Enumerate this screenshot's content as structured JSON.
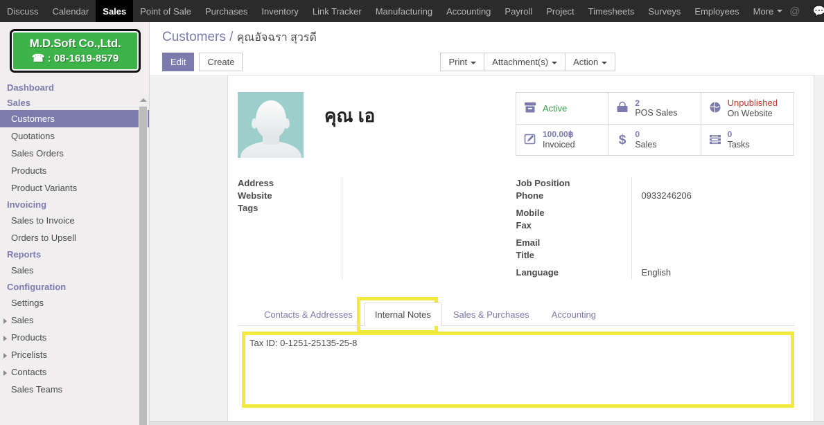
{
  "topbar": {
    "menus": [
      {
        "label": "Discuss",
        "active": false
      },
      {
        "label": "Calendar",
        "active": false
      },
      {
        "label": "Sales",
        "active": true
      },
      {
        "label": "Point of Sale",
        "active": false
      },
      {
        "label": "Purchases",
        "active": false
      },
      {
        "label": "Inventory",
        "active": false
      },
      {
        "label": "Link Tracker",
        "active": false
      },
      {
        "label": "Manufacturing",
        "active": false
      },
      {
        "label": "Accounting",
        "active": false
      },
      {
        "label": "Payroll",
        "active": false
      },
      {
        "label": "Project",
        "active": false
      },
      {
        "label": "Timesheets",
        "active": false
      },
      {
        "label": "Surveys",
        "active": false
      },
      {
        "label": "Employees",
        "active": false
      },
      {
        "label": "More",
        "active": false,
        "caret": true
      }
    ],
    "mention_icon": "@",
    "chat_icon": "messages-icon"
  },
  "sidebar": {
    "logo": {
      "company": "M.D.Soft Co.,Ltd.",
      "phone": "08-1619-8579",
      "phone_prefix": "☎ :",
      "bg_color": "#3db44a"
    },
    "entries": [
      {
        "type": "section",
        "label": "Dashboard"
      },
      {
        "type": "section",
        "label": "Sales"
      },
      {
        "type": "item",
        "label": "Customers",
        "active": true,
        "arrow": false
      },
      {
        "type": "item",
        "label": "Quotations",
        "active": false,
        "arrow": false
      },
      {
        "type": "item",
        "label": "Sales Orders",
        "active": false,
        "arrow": false
      },
      {
        "type": "item",
        "label": "Products",
        "active": false,
        "arrow": false
      },
      {
        "type": "item",
        "label": "Product Variants",
        "active": false,
        "arrow": false
      },
      {
        "type": "section",
        "label": "Invoicing"
      },
      {
        "type": "item",
        "label": "Sales to Invoice",
        "active": false,
        "arrow": false
      },
      {
        "type": "item",
        "label": "Orders to Upsell",
        "active": false,
        "arrow": false
      },
      {
        "type": "section",
        "label": "Reports"
      },
      {
        "type": "item",
        "label": "Sales",
        "active": false,
        "arrow": false
      },
      {
        "type": "section",
        "label": "Configuration"
      },
      {
        "type": "item",
        "label": "Settings",
        "active": false,
        "arrow": false
      },
      {
        "type": "item",
        "label": "Sales",
        "active": false,
        "arrow": true
      },
      {
        "type": "item",
        "label": "Products",
        "active": false,
        "arrow": true
      },
      {
        "type": "item",
        "label": "Pricelists",
        "active": false,
        "arrow": true
      },
      {
        "type": "item",
        "label": "Contacts",
        "active": false,
        "arrow": true
      },
      {
        "type": "item",
        "label": "Sales Teams",
        "active": false,
        "arrow": false
      }
    ]
  },
  "control_panel": {
    "breadcrumb_root": "Customers",
    "breadcrumb_separator": "/",
    "breadcrumb_current": "คุณอัจฉรา สุวรดี",
    "edit_label": "Edit",
    "create_label": "Create",
    "print_label": "Print",
    "attachments_label": "Attachment(s)",
    "action_label": "Action"
  },
  "record": {
    "name": "คุณ เอ",
    "avatar_bg": "#9ccfcb",
    "stats": [
      {
        "icon": "archive-icon",
        "value": "Active",
        "value_style": "green",
        "label": ""
      },
      {
        "icon": "shopping-bag-icon",
        "value": "2",
        "value_style": "purple",
        "label": "POS Sales"
      },
      {
        "icon": "globe-icon",
        "value": "Unpublished",
        "value_style": "red",
        "label": "On Website"
      },
      {
        "icon": "pencil-square-icon",
        "value": "100.00฿",
        "value_style": "purple",
        "label": "Invoiced"
      },
      {
        "icon": "dollar-icon",
        "value": "0",
        "value_style": "purple",
        "label": "Sales"
      },
      {
        "icon": "tasks-icon",
        "value": "0",
        "value_style": "purple",
        "label": "Tasks"
      }
    ],
    "left_fields": [
      {
        "label": "Address",
        "value": ""
      },
      {
        "label": "Website",
        "value": ""
      },
      {
        "label": "Tags",
        "value": ""
      }
    ],
    "right_fields": [
      {
        "label": "Job Position",
        "value": ""
      },
      {
        "label": "Phone",
        "value": "0933246206"
      },
      {
        "label": "Mobile",
        "value": ""
      },
      {
        "label": "Fax",
        "value": ""
      },
      {
        "label": "Email",
        "value": ""
      },
      {
        "label": "Title",
        "value": ""
      },
      {
        "label": "Language",
        "value": "English"
      }
    ],
    "tabs": [
      {
        "label": "Contacts & Addresses",
        "active": false
      },
      {
        "label": "Internal Notes",
        "active": true
      },
      {
        "label": "Sales & Purchases",
        "active": false
      },
      {
        "label": "Accounting",
        "active": false
      }
    ],
    "internal_notes": "Tax ID: 0-1251-25135-25-8"
  },
  "annotation": {
    "highlight_color": "#f3e93f"
  }
}
